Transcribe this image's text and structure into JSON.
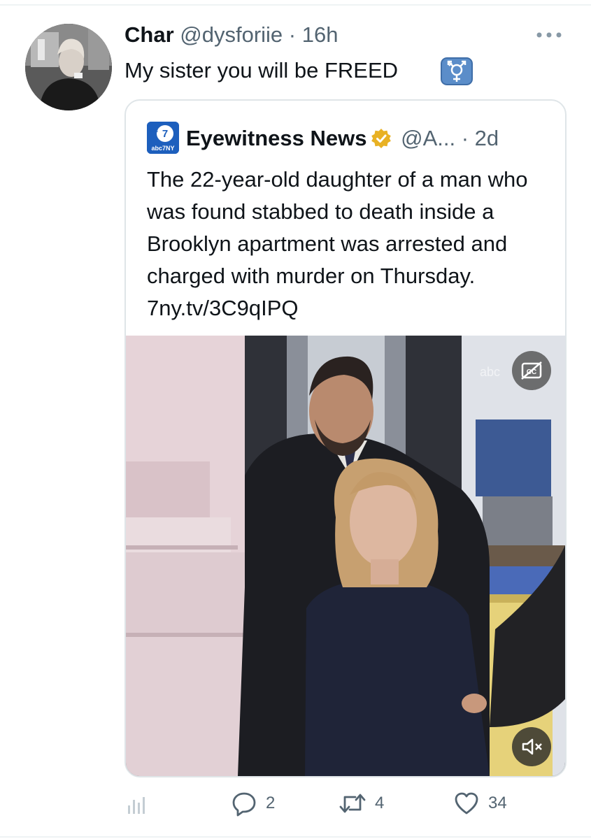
{
  "tweet": {
    "author_name": "Char",
    "author_handle": "@dysforiie",
    "separator": "·",
    "time": "16h",
    "text": "My sister you will be FREED",
    "emoji_icon": "transgender-symbol-icon"
  },
  "quote": {
    "logo_text_top": "abc",
    "logo_text_bottom": "abc7NY",
    "source_name": "Eyewitness News",
    "verified_icon": "verified-badge-gold-icon",
    "handle": "@A...",
    "separator": "·",
    "time": "2d",
    "text": "The 22-year-old daughter of a man who was found stabbed to death inside a Brooklyn apartment was arrested and charged with murder on Thursday. 7ny.tv/3C9qIPQ",
    "media": {
      "watermark": "abc",
      "cc_icon": "closed-captions-off-icon",
      "mute_icon": "speaker-muted-icon"
    }
  },
  "actions": {
    "analytics_icon": "analytics-icon",
    "reply_icon": "reply-icon",
    "reply_count": "2",
    "retweet_icon": "retweet-icon",
    "retweet_count": "4",
    "like_icon": "like-heart-icon",
    "like_count": "34"
  },
  "colors": {
    "text_primary": "#0f1419",
    "text_secondary": "#536471",
    "border": "#dfe5e8",
    "verified_gold": "#e8b124",
    "emoji_bg": "#5b8dc9"
  }
}
